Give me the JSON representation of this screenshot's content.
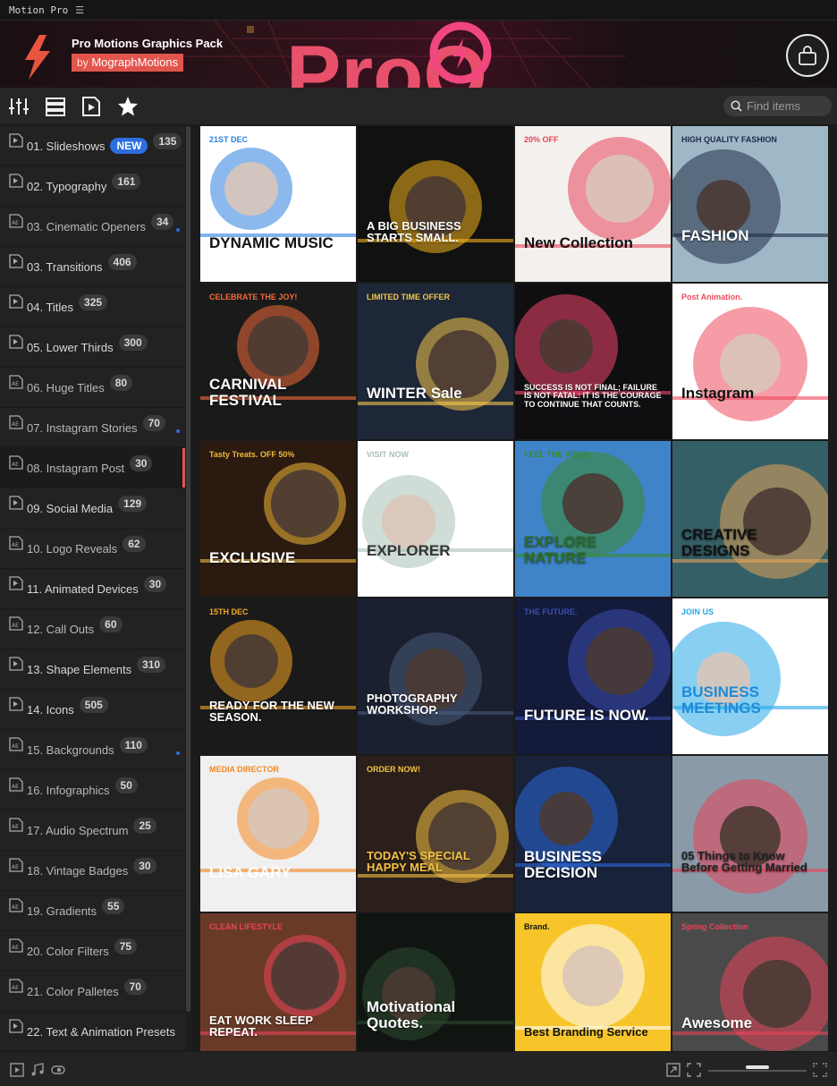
{
  "app": {
    "title": "Motion Pro",
    "menu_glyph": "☰"
  },
  "banner": {
    "title": "Pro Motions Graphics Pack",
    "by": "by",
    "author": "MographMotions",
    "big_word": "ProO"
  },
  "toolbar": {
    "search_placeholder": "Find items"
  },
  "categories": [
    {
      "label": "01. Slideshows",
      "count": "135",
      "badge": "NEW",
      "ae": false
    },
    {
      "label": "02. Typography",
      "count": "161",
      "ae": false
    },
    {
      "label": "03. Cinematic Openers",
      "count": "34",
      "ae": true,
      "dot": true
    },
    {
      "label": "03. Transitions",
      "count": "406",
      "ae": false
    },
    {
      "label": "04. Titles",
      "count": "325",
      "ae": false
    },
    {
      "label": "05. Lower Thirds",
      "count": "300",
      "ae": false
    },
    {
      "label": "06. Huge Titles",
      "count": "80",
      "ae": true
    },
    {
      "label": "07. Instagram Stories",
      "count": "70",
      "ae": true,
      "dot": true
    },
    {
      "label": "08. Instagram Post",
      "count": "30",
      "ae": true,
      "active": true
    },
    {
      "label": "09. Social Media",
      "count": "129",
      "ae": false
    },
    {
      "label": "10. Logo Reveals",
      "count": "62",
      "ae": true
    },
    {
      "label": "11. Animated Devices",
      "count": "30",
      "ae": false
    },
    {
      "label": "12. Call Outs",
      "count": "60",
      "ae": true
    },
    {
      "label": "13. Shape Elements",
      "count": "310",
      "ae": false
    },
    {
      "label": "14. Icons",
      "count": "505",
      "ae": false
    },
    {
      "label": "15. Backgrounds",
      "count": "110",
      "ae": true,
      "dot": true
    },
    {
      "label": "16. Infographics",
      "count": "50",
      "ae": true
    },
    {
      "label": "17. Audio Spectrum",
      "count": "25",
      "ae": true
    },
    {
      "label": "18. Vintage Badges",
      "count": "30",
      "ae": true
    },
    {
      "label": "19. Gradients",
      "count": "55",
      "ae": true
    },
    {
      "label": "20. Color Filters",
      "count": "75",
      "ae": true
    },
    {
      "label": "21. Color Palletes",
      "count": "70",
      "ae": true
    },
    {
      "label": "22. Text & Animation Presets",
      "count": "",
      "ae": false
    }
  ],
  "tiles": [
    {
      "text": "DYNAMIC MUSIC",
      "sub": "21ST DEC",
      "bg": "#ffffff",
      "fg": "#111111",
      "accent": "#2b7fe0"
    },
    {
      "text": "A BIG BUSINESS STARTS SMALL.",
      "sub": "",
      "bg": "#111111",
      "fg": "#ffffff",
      "accent": "#f3b21b"
    },
    {
      "text": "New Collection",
      "sub": "20% OFF",
      "bg": "#f4f0ee",
      "fg": "#111111",
      "accent": "#e8445a"
    },
    {
      "text": "FASHION",
      "sub": "HIGH QUALITY FASHION",
      "bg": "#9fb8c8",
      "fg": "#ffffff",
      "accent": "#1d2b44"
    },
    {
      "text": "CARNIVAL FESTIVAL",
      "sub": "CELEBRATE THE JOY!",
      "bg": "#1a1a1a",
      "fg": "#ffffff",
      "accent": "#f36b3a"
    },
    {
      "text": "WINTER Sale",
      "sub": "LIMITED TIME OFFER",
      "bg": "#1d2738",
      "fg": "#ffffff",
      "accent": "#f5c64a"
    },
    {
      "text": "SUCCESS IS NOT FINAL; FAILURE IS NOT FATAL: IT IS THE COURAGE TO CONTINUE THAT COUNTS.",
      "sub": "",
      "bg": "#0f0f12",
      "fg": "#ffffff",
      "accent": "#f2456a"
    },
    {
      "text": "Instagram",
      "sub": "Post Animation.",
      "bg": "#ffffff",
      "fg": "#111111",
      "accent": "#ee4a5f"
    },
    {
      "text": "EXCLUSIVE",
      "sub": "Tasty Treats. OFF 50%",
      "bg": "#2a1a10",
      "fg": "#ffffff",
      "accent": "#f2b93b"
    },
    {
      "text": "EXPLORER",
      "sub": "VISIT NOW",
      "bg": "#ffffff",
      "fg": "#333333",
      "accent": "#a9c0b4"
    },
    {
      "text": "EXPLORE NATURE",
      "sub": "FEEL THE VIBES",
      "bg": "#3f83c9",
      "fg": "#2d6b2e",
      "accent": "#3a8a2c"
    },
    {
      "text": "CREATIVE DESIGNS",
      "sub": "",
      "bg": "#345f66",
      "fg": "#111111",
      "accent": "#e3a25a"
    },
    {
      "text": "READY FOR THE NEW SEASON.",
      "sub": "15TH DEC",
      "bg": "#1a1a1a",
      "fg": "#ffffff",
      "accent": "#f5a623"
    },
    {
      "text": "PHOTOGRAPHY WORKSHOP.",
      "sub": "",
      "bg": "#1a2030",
      "fg": "#ffffff",
      "accent": "#4a5a7a"
    },
    {
      "text": "FUTURE IS NOW.",
      "sub": "THE FUTURE.",
      "bg": "#141a3a",
      "fg": "#ffffff",
      "accent": "#3a4fb0"
    },
    {
      "text": "BUSINESS MEETINGS",
      "sub": "JOIN US",
      "bg": "#ffffff",
      "fg": "#1f8bd8",
      "accent": "#27a7e8"
    },
    {
      "text": "LISA GARY",
      "sub": "MEDIA DIRECTOR",
      "bg": "#f0f0f0",
      "fg": "#ffffff",
      "accent": "#f5861f"
    },
    {
      "text": "TODAY'S SPECIAL HAPPY MEAL",
      "sub": "ORDER NOW!",
      "bg": "#2a1f1a",
      "fg": "#f5c344",
      "accent": "#f5c344"
    },
    {
      "text": "BUSINESS DECISION",
      "sub": "",
      "bg": "#18223a",
      "fg": "#ffffff",
      "accent": "#2b67d8"
    },
    {
      "text": "05 Things to Know Before Getting Married",
      "sub": "",
      "bg": "#8a9aa8",
      "fg": "#222222",
      "accent": "#e8445a"
    },
    {
      "text": "EAT WORK SLEEP REPEAT.",
      "sub": "CLEAN LIFESTYLE",
      "bg": "#6a3a28",
      "fg": "#ffffff",
      "accent": "#e8445a"
    },
    {
      "text": "Motivational Quotes.",
      "sub": "",
      "bg": "#101512",
      "fg": "#ffffff",
      "accent": "#2d4a30"
    },
    {
      "text": "Best Branding Service",
      "sub": "Brand.",
      "bg": "#f7c52a",
      "fg": "#111111",
      "accent": "#ffffff"
    },
    {
      "text": "Awesome",
      "sub": "Spring Collection",
      "bg": "#4a4a4a",
      "fg": "#ffffff",
      "accent": "#e8445a"
    }
  ]
}
